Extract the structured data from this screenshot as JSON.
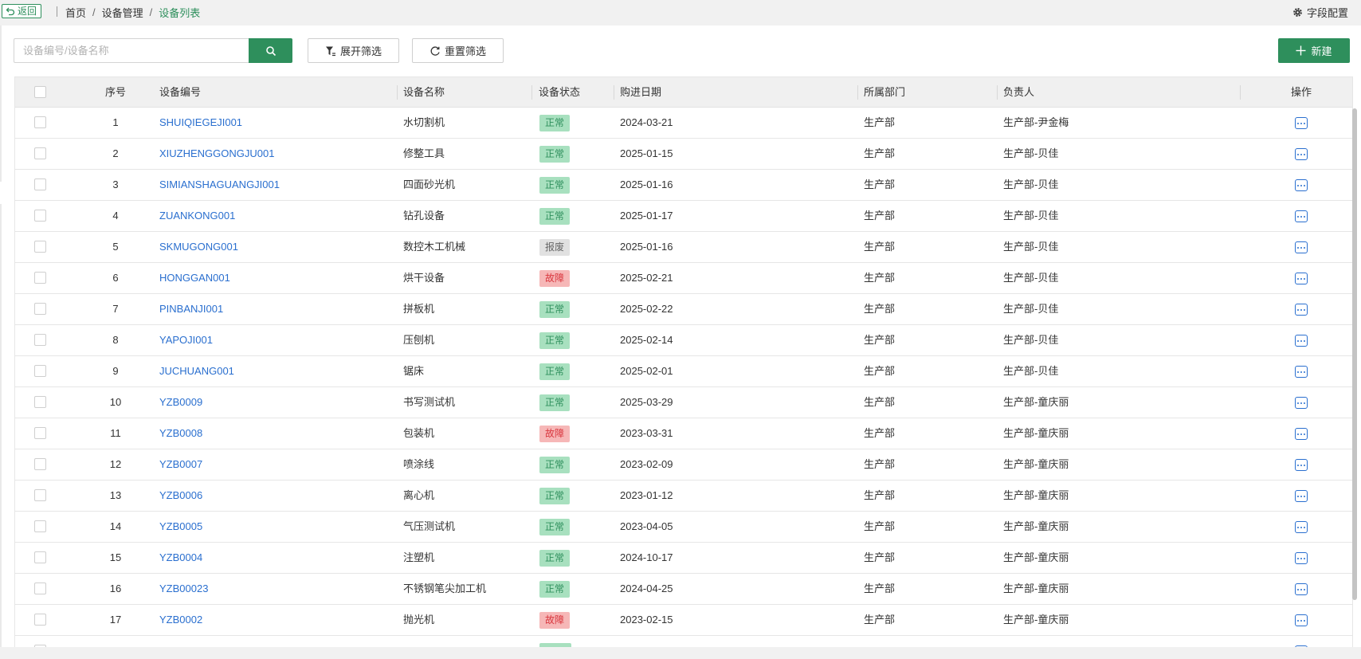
{
  "topbar": {
    "back_label": "返回",
    "breadcrumb": [
      "首页",
      "设备管理",
      "设备列表"
    ],
    "breadcrumb_sep": "/",
    "field_config_label": "字段配置"
  },
  "toolbar": {
    "search_placeholder": "设备编号/设备名称",
    "search_value": "",
    "filter_label": "展开筛选",
    "reset_label": "重置筛选",
    "new_label": "新建"
  },
  "table": {
    "headers": {
      "index": "序号",
      "code": "设备编号",
      "name": "设备名称",
      "status": "设备状态",
      "date": "购进日期",
      "dept": "所属部门",
      "owner": "负责人",
      "actions": "操作"
    },
    "rows": [
      {
        "index": "1",
        "code": "SHUIQIEGEJI001",
        "name": "水切割机",
        "status": "正常",
        "status_type": "ok",
        "date": "2024-03-21",
        "dept": "生产部",
        "owner": "生产部-尹金梅"
      },
      {
        "index": "2",
        "code": "XIUZHENGGONGJU001",
        "name": "修整工具",
        "status": "正常",
        "status_type": "ok",
        "date": "2025-01-15",
        "dept": "生产部",
        "owner": "生产部-贝佳"
      },
      {
        "index": "3",
        "code": "SIMIANSHAGUANGJI001",
        "name": "四面砂光机",
        "status": "正常",
        "status_type": "ok",
        "date": "2025-01-16",
        "dept": "生产部",
        "owner": "生产部-贝佳"
      },
      {
        "index": "4",
        "code": "ZUANKONG001",
        "name": "钻孔设备",
        "status": "正常",
        "status_type": "ok",
        "date": "2025-01-17",
        "dept": "生产部",
        "owner": "生产部-贝佳"
      },
      {
        "index": "5",
        "code": "SKMUGONG001",
        "name": "数控木工机械",
        "status": "报废",
        "status_type": "scrap",
        "date": "2025-01-16",
        "dept": "生产部",
        "owner": "生产部-贝佳"
      },
      {
        "index": "6",
        "code": "HONGGAN001",
        "name": "烘干设备",
        "status": "故障",
        "status_type": "fault",
        "date": "2025-02-21",
        "dept": "生产部",
        "owner": "生产部-贝佳"
      },
      {
        "index": "7",
        "code": "PINBANJI001",
        "name": "拼板机",
        "status": "正常",
        "status_type": "ok",
        "date": "2025-02-22",
        "dept": "生产部",
        "owner": "生产部-贝佳"
      },
      {
        "index": "8",
        "code": "YAPOJI001",
        "name": "压刨机",
        "status": "正常",
        "status_type": "ok",
        "date": "2025-02-14",
        "dept": "生产部",
        "owner": "生产部-贝佳"
      },
      {
        "index": "9",
        "code": "JUCHUANG001",
        "name": "锯床",
        "status": "正常",
        "status_type": "ok",
        "date": "2025-02-01",
        "dept": "生产部",
        "owner": "生产部-贝佳"
      },
      {
        "index": "10",
        "code": "YZB0009",
        "name": "书写测试机",
        "status": "正常",
        "status_type": "ok",
        "date": "2025-03-29",
        "dept": "生产部",
        "owner": "生产部-童庆丽"
      },
      {
        "index": "11",
        "code": "YZB0008",
        "name": "包装机",
        "status": "故障",
        "status_type": "fault",
        "date": "2023-03-31",
        "dept": "生产部",
        "owner": "生产部-童庆丽"
      },
      {
        "index": "12",
        "code": "YZB0007",
        "name": "喷涂线",
        "status": "正常",
        "status_type": "ok",
        "date": "2023-02-09",
        "dept": "生产部",
        "owner": "生产部-童庆丽"
      },
      {
        "index": "13",
        "code": "YZB0006",
        "name": "离心机",
        "status": "正常",
        "status_type": "ok",
        "date": "2023-01-12",
        "dept": "生产部",
        "owner": "生产部-童庆丽"
      },
      {
        "index": "14",
        "code": "YZB0005",
        "name": "气压测试机",
        "status": "正常",
        "status_type": "ok",
        "date": "2023-04-05",
        "dept": "生产部",
        "owner": "生产部-童庆丽"
      },
      {
        "index": "15",
        "code": "YZB0004",
        "name": "注塑机",
        "status": "正常",
        "status_type": "ok",
        "date": "2024-10-17",
        "dept": "生产部",
        "owner": "生产部-童庆丽"
      },
      {
        "index": "16",
        "code": "YZB00023",
        "name": "不锈钢笔尖加工机",
        "status": "正常",
        "status_type": "ok",
        "date": "2024-04-25",
        "dept": "生产部",
        "owner": "生产部-童庆丽"
      },
      {
        "index": "17",
        "code": "YZB0002",
        "name": "抛光机",
        "status": "故障",
        "status_type": "fault",
        "date": "2023-02-15",
        "dept": "生产部",
        "owner": "生产部-童庆丽"
      },
      {
        "index": "",
        "code": "",
        "name": "",
        "status": "",
        "status_type": "ok",
        "date": "",
        "dept": "",
        "owner": ""
      }
    ]
  },
  "colors": {
    "accent": "#2e8f5c",
    "link": "#2a6fcf",
    "status_ok_bg": "#a8e0bf",
    "status_fault_bg": "#f6b7b7",
    "status_scrap_bg": "#e1e1e1"
  },
  "icons": {
    "back": "return-arrow-icon",
    "field_config": "gear-icon",
    "search": "search-icon",
    "filter": "filter-icon",
    "reset": "refresh-icon",
    "new": "plus-icon",
    "row_action": "more-icon"
  }
}
